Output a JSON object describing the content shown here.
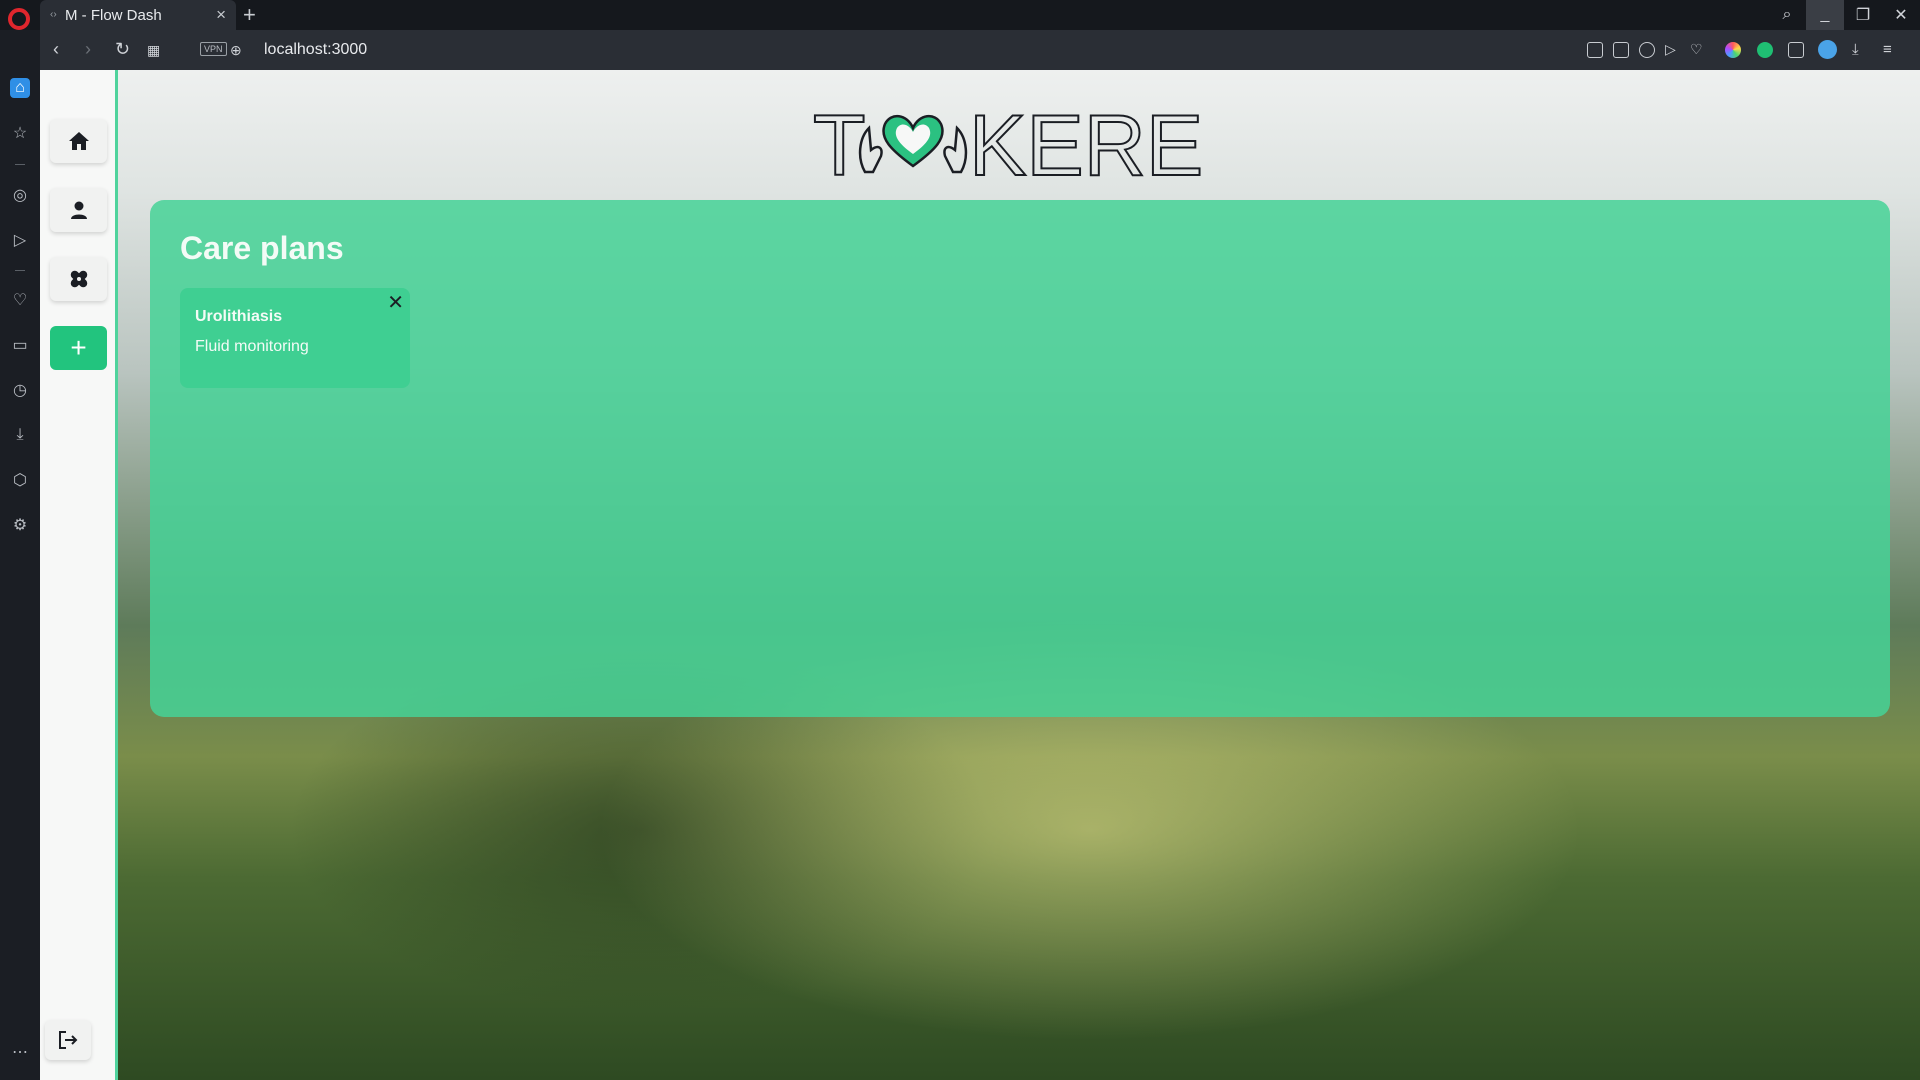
{
  "browser": {
    "tab_title": "M - Flow Dash",
    "url": "localhost:3000",
    "vpn_label": "VPN"
  },
  "app": {
    "logo_text_left": "T",
    "logo_text_right": "KERE",
    "nav_items": [
      {
        "name": "home",
        "icon": "home-icon"
      },
      {
        "name": "profile",
        "icon": "person-icon"
      },
      {
        "name": "care-plans",
        "icon": "bandage-icon"
      },
      {
        "name": "add",
        "icon": "plus-icon"
      }
    ],
    "logout_icon": "logout-icon",
    "accent_color": "#22c47e"
  },
  "main": {
    "title": "Care plans",
    "cards": [
      {
        "title": "Urolithiasis",
        "subtitle": "Fluid monitoring"
      }
    ]
  }
}
